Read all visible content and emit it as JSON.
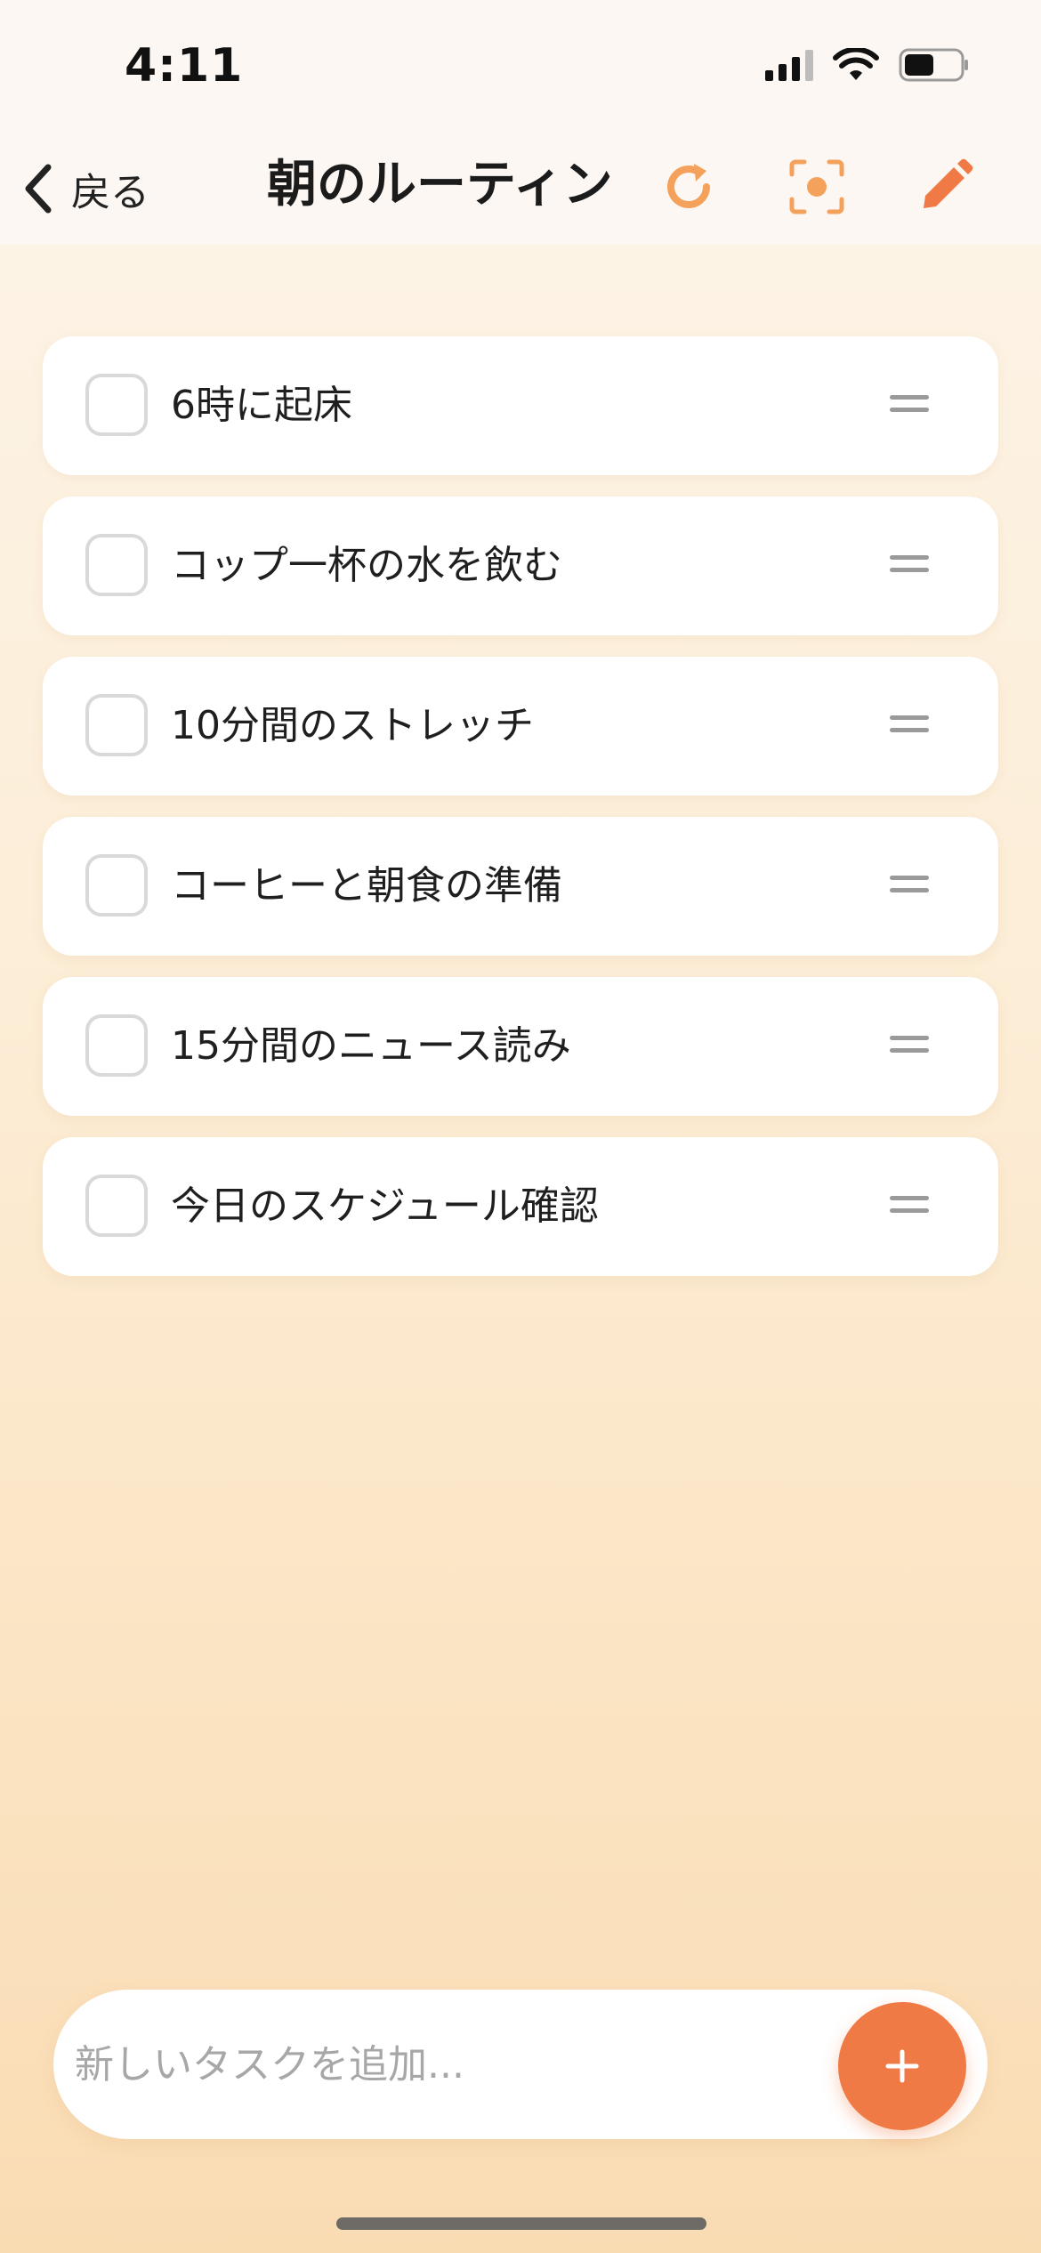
{
  "status_bar": {
    "time": "4:11"
  },
  "nav": {
    "back_label": "戻る",
    "title": "朝のルーティン"
  },
  "colors": {
    "accent": "#f07a45",
    "accent_light": "#f4a15c",
    "background_top": "#fdf5ea",
    "background_bottom": "#fadcb3"
  },
  "icons": {
    "back": "chevron-left-icon",
    "refresh": "refresh-icon",
    "focus": "focus-icon",
    "edit": "pencil-icon",
    "drag": "drag-handle-icon",
    "add": "plus-icon"
  },
  "tasks": [
    {
      "text": "6時に起床",
      "done": false
    },
    {
      "text": "コップ一杯の水を飲む",
      "done": false
    },
    {
      "text": "10分間のストレッチ",
      "done": false
    },
    {
      "text": "コーヒーと朝食の準備",
      "done": false
    },
    {
      "text": "15分間のニュース読み",
      "done": false
    },
    {
      "text": "今日のスケジュール確認",
      "done": false
    }
  ],
  "add_bar": {
    "placeholder": "新しいタスクを追加..."
  }
}
